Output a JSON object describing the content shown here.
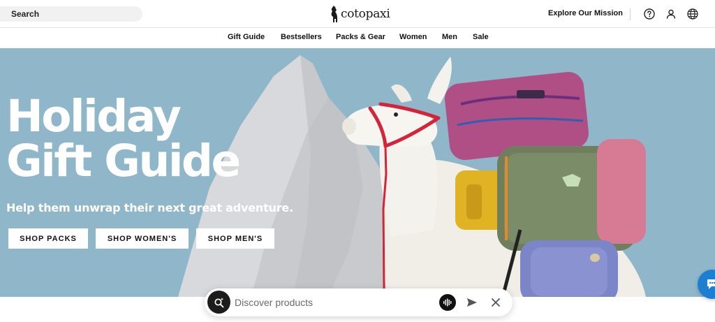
{
  "header": {
    "search_label": "Search",
    "logo_text": "cotopaxi",
    "mission_link": "Explore Our Mission",
    "icons": [
      "help-icon",
      "account-icon",
      "globe-icon"
    ]
  },
  "nav": {
    "items": [
      "Gift Guide",
      "Bestsellers",
      "Packs & Gear",
      "Women",
      "Men",
      "Sale"
    ]
  },
  "hero": {
    "title_line1": "Holiday",
    "title_line2": "Gift Guide",
    "subtitle": "Help them unwrap their next great adventure.",
    "buttons": [
      "SHOP PACKS",
      "SHOP WOMEN'S",
      "SHOP MEN'S"
    ],
    "background_color": "#8fb6c9"
  },
  "discover_bar": {
    "placeholder": "Discover products",
    "icons": [
      "search-sparkle-icon",
      "voice-wave-icon",
      "send-icon",
      "close-icon"
    ]
  },
  "chat": {
    "icon": "chat-icon",
    "color": "#1d7fd1"
  }
}
